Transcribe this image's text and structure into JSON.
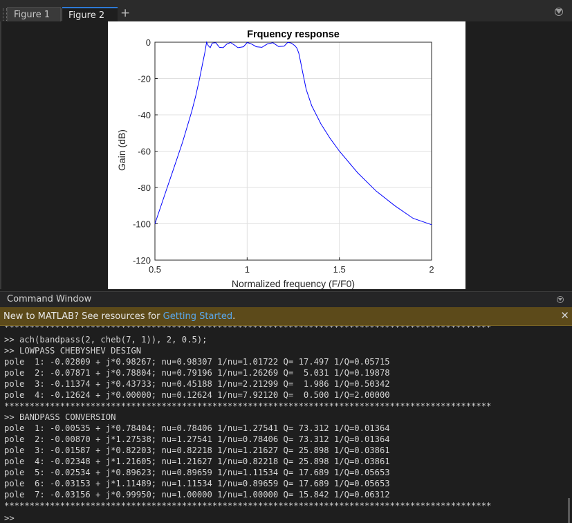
{
  "tabs": [
    {
      "label": "Figure 1"
    },
    {
      "label": "Figure 2"
    }
  ],
  "add_tab_symbol": "+",
  "figure": {
    "title": "Frquency response",
    "xlabel": "Normalized frequency (F/F0)",
    "ylabel": "Gain (dB)"
  },
  "chart_data": {
    "type": "line",
    "title": "Frquency response",
    "xlabel": "Normalized frequency (F/F0)",
    "ylabel": "Gain (dB)",
    "xlim": [
      0.5,
      2
    ],
    "ylim": [
      -120,
      0
    ],
    "xticks": [
      "0.5",
      "1",
      "1.5",
      "2"
    ],
    "yticks": [
      "0",
      "-20",
      "-40",
      "-60",
      "-80",
      "-100",
      "-120"
    ],
    "grid": true,
    "series_color": "#0000ff",
    "series": [
      {
        "x": [
          0.5,
          0.55,
          0.6,
          0.65,
          0.7,
          0.72,
          0.74,
          0.76,
          0.77,
          0.78,
          0.79,
          0.8,
          0.81,
          0.83,
          0.85,
          0.87,
          0.89,
          0.91,
          0.93,
          0.95,
          0.98,
          1.0,
          1.02,
          1.05,
          1.08,
          1.11,
          1.14,
          1.17,
          1.2,
          1.22,
          1.24,
          1.26,
          1.27,
          1.28,
          1.29,
          1.3,
          1.32,
          1.35,
          1.4,
          1.45,
          1.5,
          1.6,
          1.7,
          1.8,
          1.9,
          2.0
        ],
        "y": [
          -100,
          -85,
          -70,
          -55,
          -38,
          -30,
          -21,
          -11,
          -6,
          0,
          -2,
          -3,
          -0.5,
          -0.3,
          -2.8,
          -3,
          -1,
          -0.2,
          -1.5,
          -3,
          -2.5,
          -0.2,
          -0.8,
          -2.5,
          -2.8,
          -0.9,
          -0.3,
          -2.4,
          -2.2,
          -0.1,
          -0.5,
          -2,
          -3.3,
          -6,
          -11,
          -16,
          -26,
          -35,
          -45,
          -53,
          -60,
          -72,
          -82,
          -90,
          -97,
          -100.5
        ]
      }
    ]
  },
  "command_window": {
    "title": "Command Window",
    "banner_text": "New to MATLAB? See resources for ",
    "banner_link": "Getting Started",
    "banner_suffix": ".",
    "lines": [
      "************************************************************************************************",
      ">> ach(bandpass(2, cheb(7, 1)), 2, 0.5);",
      ">> LOWPASS CHEBYSHEV DESIGN",
      "pole  1: -0.02809 + j*0.98267; nu=0.98307 1/nu=1.01722 Q= 17.497 1/Q=0.05715",
      "pole  2: -0.07871 + j*0.78804; nu=0.79196 1/nu=1.26269 Q=  5.031 1/Q=0.19878",
      "pole  3: -0.11374 + j*0.43733; nu=0.45188 1/nu=2.21299 Q=  1.986 1/Q=0.50342",
      "pole  4: -0.12624 + j*0.00000; nu=0.12624 1/nu=7.92120 Q=  0.500 1/Q=2.00000",
      "************************************************************************************************",
      ">> BANDPASS CONVERSION",
      "pole  1: -0.00535 + j*0.78404; nu=0.78406 1/nu=1.27541 Q= 73.312 1/Q=0.01364",
      "pole  2: -0.00870 + j*1.27538; nu=1.27541 1/nu=0.78406 Q= 73.312 1/Q=0.01364",
      "pole  3: -0.01587 + j*0.82203; nu=0.82218 1/nu=1.21627 Q= 25.898 1/Q=0.03861",
      "pole  4: -0.02348 + j*1.21605; nu=1.21627 1/nu=0.82218 Q= 25.898 1/Q=0.03861",
      "pole  5: -0.02534 + j*0.89623; nu=0.89659 1/nu=1.11534 Q= 17.689 1/Q=0.05653",
      "pole  6: -0.03153 + j*1.11489; nu=1.11534 1/nu=0.89659 Q= 17.689 1/Q=0.05653",
      "pole  7: -0.03156 + j*0.99950; nu=1.00000 1/nu=1.00000 Q= 15.842 1/Q=0.06312",
      "************************************************************************************************"
    ],
    "prompt": ">>"
  }
}
